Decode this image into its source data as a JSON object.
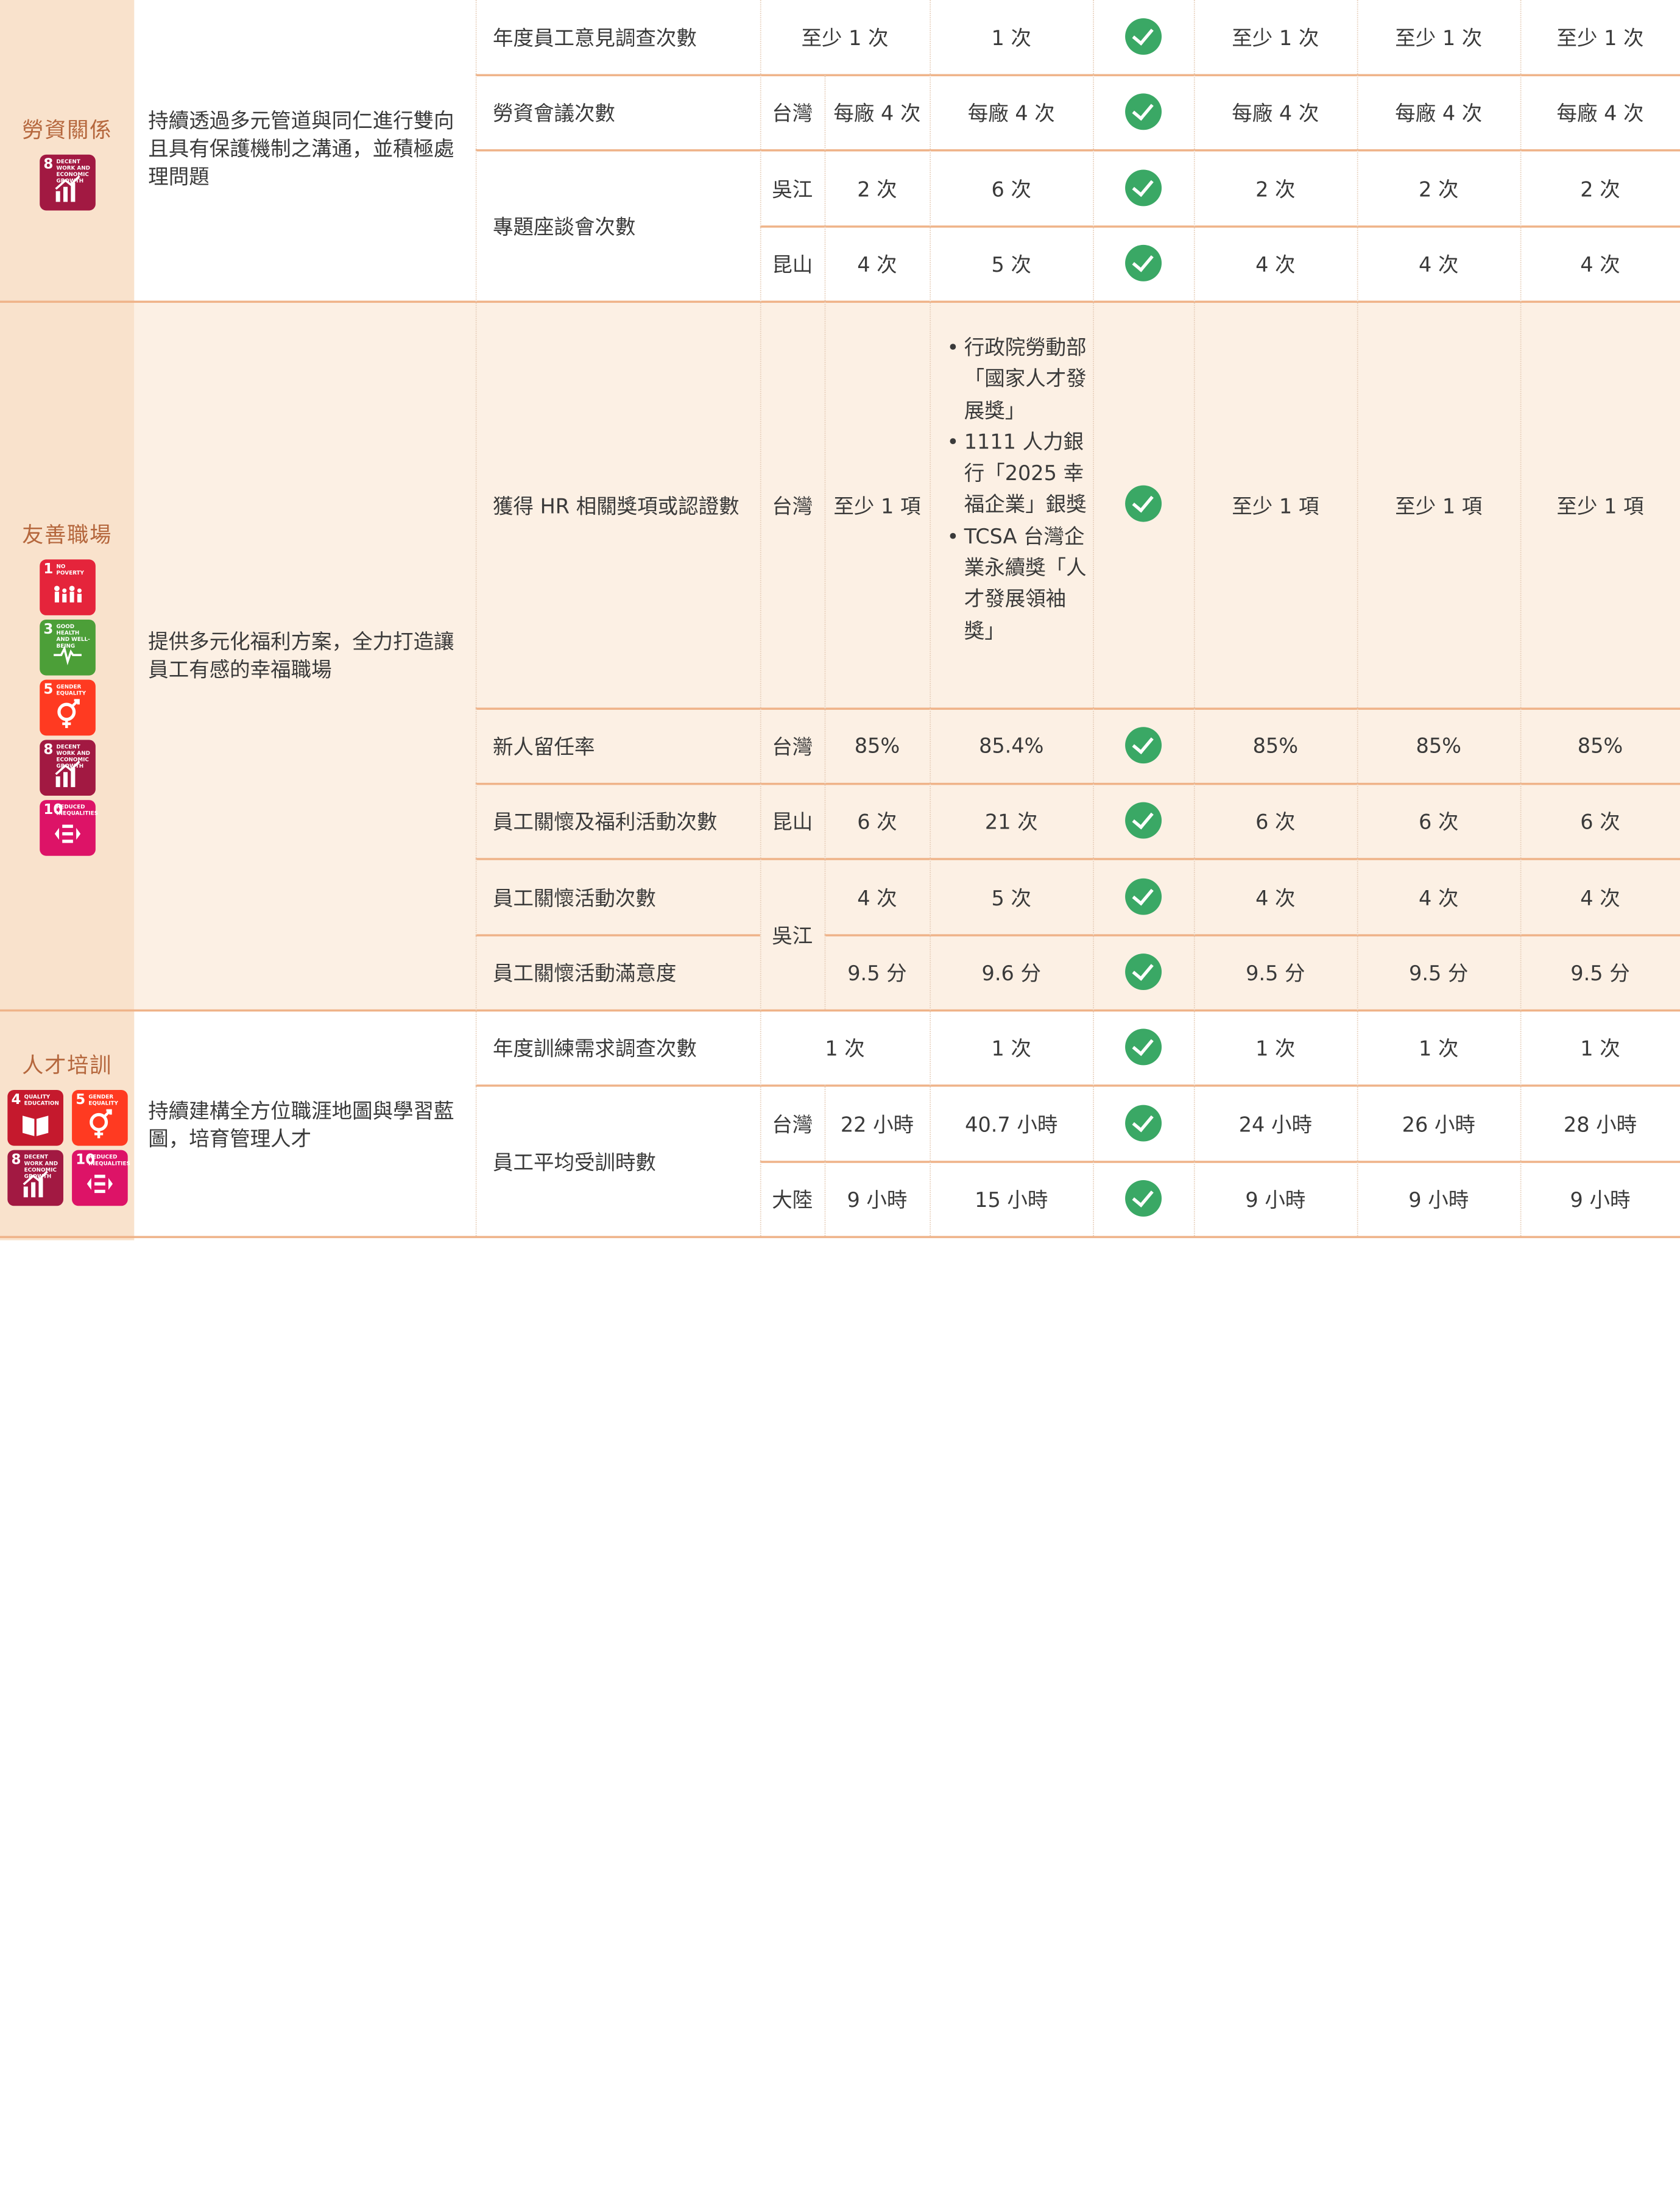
{
  "colors": {
    "accent": "#efb389",
    "band": "#fcf0e4",
    "category_col": "#f9e2cc",
    "check": "#3aa865"
  },
  "sections": [
    {
      "category": "勞資關係",
      "goal": "持續透過多元管道與同仁進行雙向且具有保護機制之溝通，並積極處理問題",
      "sdgs": [
        {
          "num": "8",
          "label": "DECENT WORK AND ECONOMIC GROWTH",
          "color": "#a21942"
        }
      ],
      "rows": [
        {
          "indicator": "年度員工意見調查次數",
          "region": "",
          "target": "至少 1 次",
          "actual": "1 次",
          "achieved": true,
          "y1": "至少 1 次",
          "y2": "至少 1 次",
          "y3": "至少 1 次"
        },
        {
          "indicator": "勞資會議次數",
          "region": "台灣",
          "target": "每廠 4 次",
          "actual": "每廠 4 次",
          "achieved": true,
          "y1": "每廠 4 次",
          "y2": "每廠 4 次",
          "y3": "每廠 4 次"
        },
        {
          "indicator": "專題座談會次數",
          "region": "吳江",
          "target": "2 次",
          "actual": "6 次",
          "achieved": true,
          "y1": "2 次",
          "y2": "2 次",
          "y3": "2 次"
        },
        {
          "indicator": "",
          "region": "昆山",
          "target": "4 次",
          "actual": "5 次",
          "achieved": true,
          "y1": "4 次",
          "y2": "4 次",
          "y3": "4 次"
        }
      ]
    },
    {
      "category": "友善職場",
      "goal": "提供多元化福利方案，全力打造讓員工有感的幸福職場",
      "sdgs": [
        {
          "num": "1",
          "label": "NO POVERTY",
          "color": "#e5243b"
        },
        {
          "num": "3",
          "label": "GOOD HEALTH AND WELL-BEING",
          "color": "#4c9f38"
        },
        {
          "num": "5",
          "label": "GENDER EQUALITY",
          "color": "#ff3a21"
        },
        {
          "num": "8",
          "label": "DECENT WORK AND ECONOMIC GROWTH",
          "color": "#a21942"
        },
        {
          "num": "10",
          "label": "REDUCED INEQUALITIES",
          "color": "#dd1367"
        }
      ],
      "rows": [
        {
          "indicator": "獲得 HR 相關獎項或認證數",
          "region": "台灣",
          "target": "至少 1 項",
          "actual_bullets": [
            "行政院勞動部「國家人才發展獎」",
            "1111 人力銀行「2025 幸福企業」銀獎",
            "TCSA 台灣企業永續獎「人才發展領袖獎」"
          ],
          "achieved": true,
          "y1": "至少 1 項",
          "y2": "至少 1 項",
          "y3": "至少 1 項"
        },
        {
          "indicator": "新人留任率",
          "region": "台灣",
          "target": "85%",
          "actual": "85.4%",
          "achieved": true,
          "y1": "85%",
          "y2": "85%",
          "y3": "85%"
        },
        {
          "indicator": "員工關懷及福利活動次數",
          "region": "昆山",
          "target": "6 次",
          "actual": "21 次",
          "achieved": true,
          "y1": "6 次",
          "y2": "6 次",
          "y3": "6 次"
        },
        {
          "indicator": "員工關懷活動次數",
          "region": "吳江",
          "target": "4 次",
          "actual": "5 次",
          "achieved": true,
          "y1": "4 次",
          "y2": "4 次",
          "y3": "4 次"
        },
        {
          "indicator": "員工關懷活動滿意度",
          "region": "",
          "target": "9.5 分",
          "actual": "9.6 分",
          "achieved": true,
          "y1": "9.5 分",
          "y2": "9.5 分",
          "y3": "9.5 分"
        }
      ]
    },
    {
      "category": "人才培訓",
      "goal": "持續建構全方位職涯地圖與學習藍圖，培育管理人才",
      "sdgs": [
        {
          "num": "4",
          "label": "QUALITY EDUCATION",
          "color": "#c5192d"
        },
        {
          "num": "5",
          "label": "GENDER EQUALITY",
          "color": "#ff3a21"
        },
        {
          "num": "8",
          "label": "DECENT WORK AND ECONOMIC GROWTH",
          "color": "#a21942"
        },
        {
          "num": "10",
          "label": "REDUCED INEQUALITIES",
          "color": "#dd1367"
        }
      ],
      "rows": [
        {
          "indicator": "年度訓練需求調查次數",
          "region": "",
          "target": "1 次",
          "actual": "1 次",
          "achieved": true,
          "y1": "1 次",
          "y2": "1 次",
          "y3": "1 次"
        },
        {
          "indicator": "員工平均受訓時數",
          "region": "台灣",
          "target": "22 小時",
          "actual": "40.7 小時",
          "achieved": true,
          "y1": "24 小時",
          "y2": "26 小時",
          "y3": "28 小時"
        },
        {
          "indicator": "",
          "region": "大陸",
          "target": "9 小時",
          "actual": "15 小時",
          "achieved": true,
          "y1": "9 小時",
          "y2": "9 小時",
          "y3": "9 小時"
        }
      ]
    }
  ]
}
